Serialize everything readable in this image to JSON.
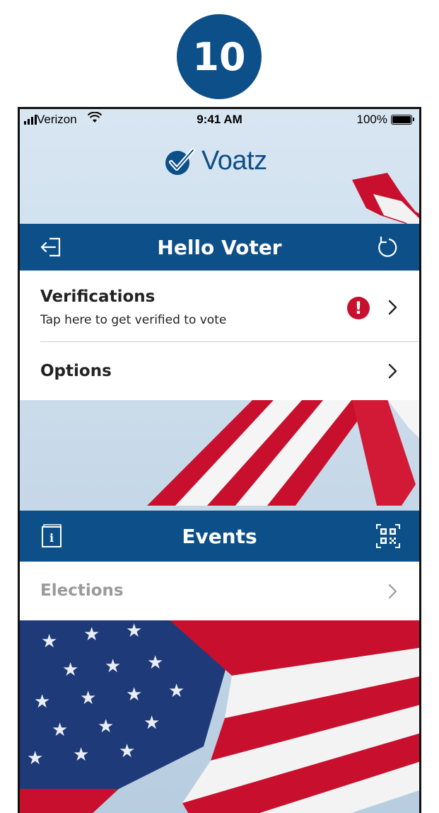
{
  "step_number": "10",
  "status_bar": {
    "carrier": "Verizon",
    "time": "9:41 AM",
    "battery": "100%"
  },
  "app": {
    "logo_text": "Voatz",
    "brand_color": "#0d4f88",
    "alert_color": "#c8102e"
  },
  "header_bar": {
    "title": "Hello Voter",
    "left_icon": "logout-icon",
    "right_icon": "refresh-icon"
  },
  "menu": {
    "verifications": {
      "title": "Verifications",
      "subtitle": "Tap here to get verified to vote",
      "badge": "!"
    },
    "options": {
      "title": "Options"
    }
  },
  "events_bar": {
    "title": "Events",
    "left_icon": "info-icon",
    "right_icon": "qr-code-icon"
  },
  "events": {
    "elections": {
      "title": "Elections"
    }
  }
}
